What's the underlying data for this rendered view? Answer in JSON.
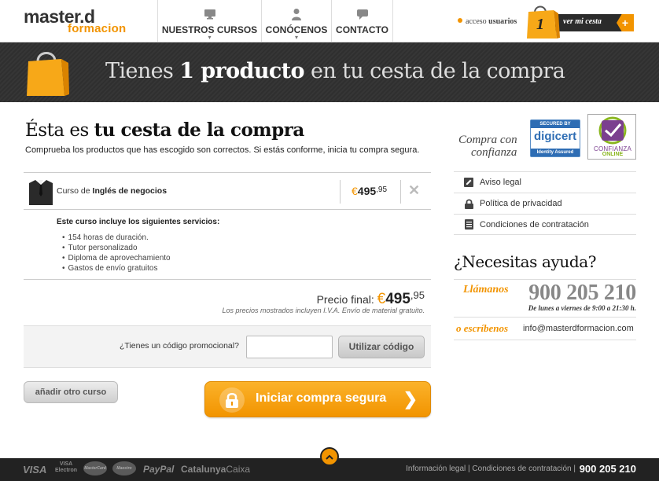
{
  "header": {
    "logo_line1": "master.D",
    "logo_line2": "Formacion",
    "nav": [
      {
        "label": "NUESTROS CURSOS",
        "icon": "monitor-icon"
      },
      {
        "label": "CONÓCENOS",
        "icon": "person-icon"
      },
      {
        "label": "CONTACTO",
        "icon": "speech-bubble-icon"
      }
    ],
    "acceso_prefix": "acceso",
    "acceso_bold": "usuarios",
    "cart_count": "1",
    "cart_label": "ver mi cesta",
    "cart_plus": "+"
  },
  "banner": {
    "title_a": "Tienes",
    "title_b": "1 producto",
    "title_c": "en tu cesta de la compra"
  },
  "main": {
    "title_a": "Ésta es",
    "title_b": "tu cesta de la compra",
    "description": "Comprueba los productos que has escogido son correctos. Si estás conforme, inicia tu compra segura.",
    "product": {
      "name_prefix": "Curso de",
      "name_bold": "Inglés de negocios",
      "currency": "€",
      "price_int": "495",
      "price_dec": ",95",
      "remove": "✕"
    },
    "services_title": "Este curso incluye los siguientes servicios:",
    "services": [
      "154 horas de duración.",
      "Tutor personalizado",
      "Diploma de aprovechamiento",
      "Gastos de envío gratuitos"
    ],
    "final_label": "Precio final:",
    "final_currency": "€",
    "final_int": "495",
    "final_dec": ",95",
    "final_note": "Los precios mostrados incluyen I.V.A. Envío de material gratuito.",
    "promo_label": "¿Tienes un código promocional?",
    "promo_value": "",
    "promo_button": "Utilizar código",
    "add_button": "añadir otro curso",
    "buy_button": "Iniciar compra segura",
    "buy_arrow": "❯"
  },
  "sidebar": {
    "confianza_line1": "Compra con",
    "confianza_line2": "confianza",
    "digicert_top": "SECURED BY",
    "digicert_mid": "digicert",
    "digicert_bottom": "Identity Assured",
    "co_line1": "CONFIANZA",
    "co_line2": "ONLINE",
    "links": [
      {
        "label": "Aviso legal",
        "icon": "pencil-icon"
      },
      {
        "label": "Política de privacidad",
        "icon": "lock-icon"
      },
      {
        "label": "Condiciones de contratación",
        "icon": "document-icon"
      }
    ],
    "help_title": "¿Necesitas ayuda?",
    "llamanos": "Llámanos",
    "phone": "900 205 210",
    "horario": "De lunes a viernes de 9:00 a 21:30 h.",
    "escribenos": "o escríbenos",
    "email": "info@masterdformacion.com"
  },
  "footer": {
    "visa": "VISA",
    "visa_electron_1": "VISA",
    "visa_electron_2": "Electron",
    "mastercard": "MasterCard",
    "maestro": "Maestro",
    "paypal": "PayPal",
    "caixa_bold": "Catalunya",
    "caixa_light": "Caixa",
    "links": "Información legal | Condiciones de contratación |",
    "phone": "900 205 210"
  },
  "colors": {
    "accent": "#f29400",
    "banner_bg": "#333333",
    "footer_bg": "#222222"
  }
}
